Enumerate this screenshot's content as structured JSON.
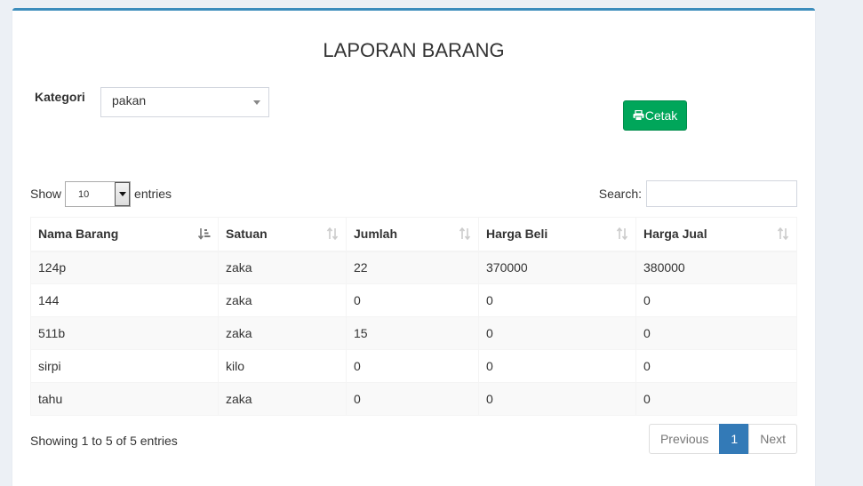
{
  "page": {
    "title": "LAPORAN BARANG"
  },
  "filter": {
    "label": "Kategori",
    "selected": "pakan"
  },
  "actions": {
    "print_label": "Cetak",
    "print_icon": "print-icon"
  },
  "table_controls": {
    "show_label": "Show",
    "page_length": "10",
    "entries_label": "entries",
    "search_label": "Search:"
  },
  "table": {
    "columns": [
      "Nama Barang",
      "Satuan",
      "Jumlah",
      "Harga Beli",
      "Harga Jual"
    ],
    "rows": [
      [
        "124p",
        "zaka",
        "22",
        "370000",
        "380000"
      ],
      [
        "144",
        "zaka",
        "0",
        "0",
        "0"
      ],
      [
        "511b",
        "zaka",
        "15",
        "0",
        "0"
      ],
      [
        "sirpi",
        "kilo",
        "0",
        "0",
        "0"
      ],
      [
        "tahu",
        "zaka",
        "0",
        "0",
        "0"
      ]
    ]
  },
  "footer": {
    "info": "Showing 1 to 5 of 5 entries",
    "previous": "Previous",
    "current_page": "1",
    "next": "Next"
  },
  "colors": {
    "accent": "#3c8dbc",
    "success": "#00a65a",
    "page_active": "#337ab7"
  }
}
